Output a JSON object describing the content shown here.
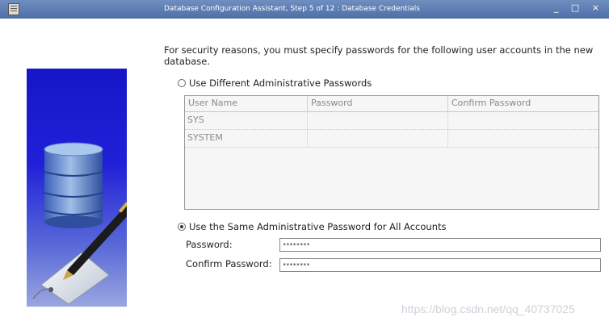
{
  "window": {
    "title": "Database Configuration Assistant, Step 5 of 12 : Database Credentials",
    "controls": "_ □ ×"
  },
  "intro_text": "For security reasons, you must specify passwords for the following user accounts in the new database.",
  "options": {
    "different": {
      "label": "Use Different Administrative Passwords",
      "selected": false
    },
    "same": {
      "label": "Use the Same Administrative Password for All Accounts",
      "selected": true
    }
  },
  "table": {
    "columns": [
      "User Name",
      "Password",
      "Confirm Password"
    ],
    "rows": [
      {
        "user": "SYS",
        "password": "",
        "confirm": ""
      },
      {
        "user": "SYSTEM",
        "password": "",
        "confirm": ""
      }
    ]
  },
  "password": {
    "label": "Password:",
    "value": "********"
  },
  "confirm_password": {
    "label": "Confirm Password:",
    "value": "********"
  },
  "watermark": "https://blog.csdn.net/qq_40737025"
}
